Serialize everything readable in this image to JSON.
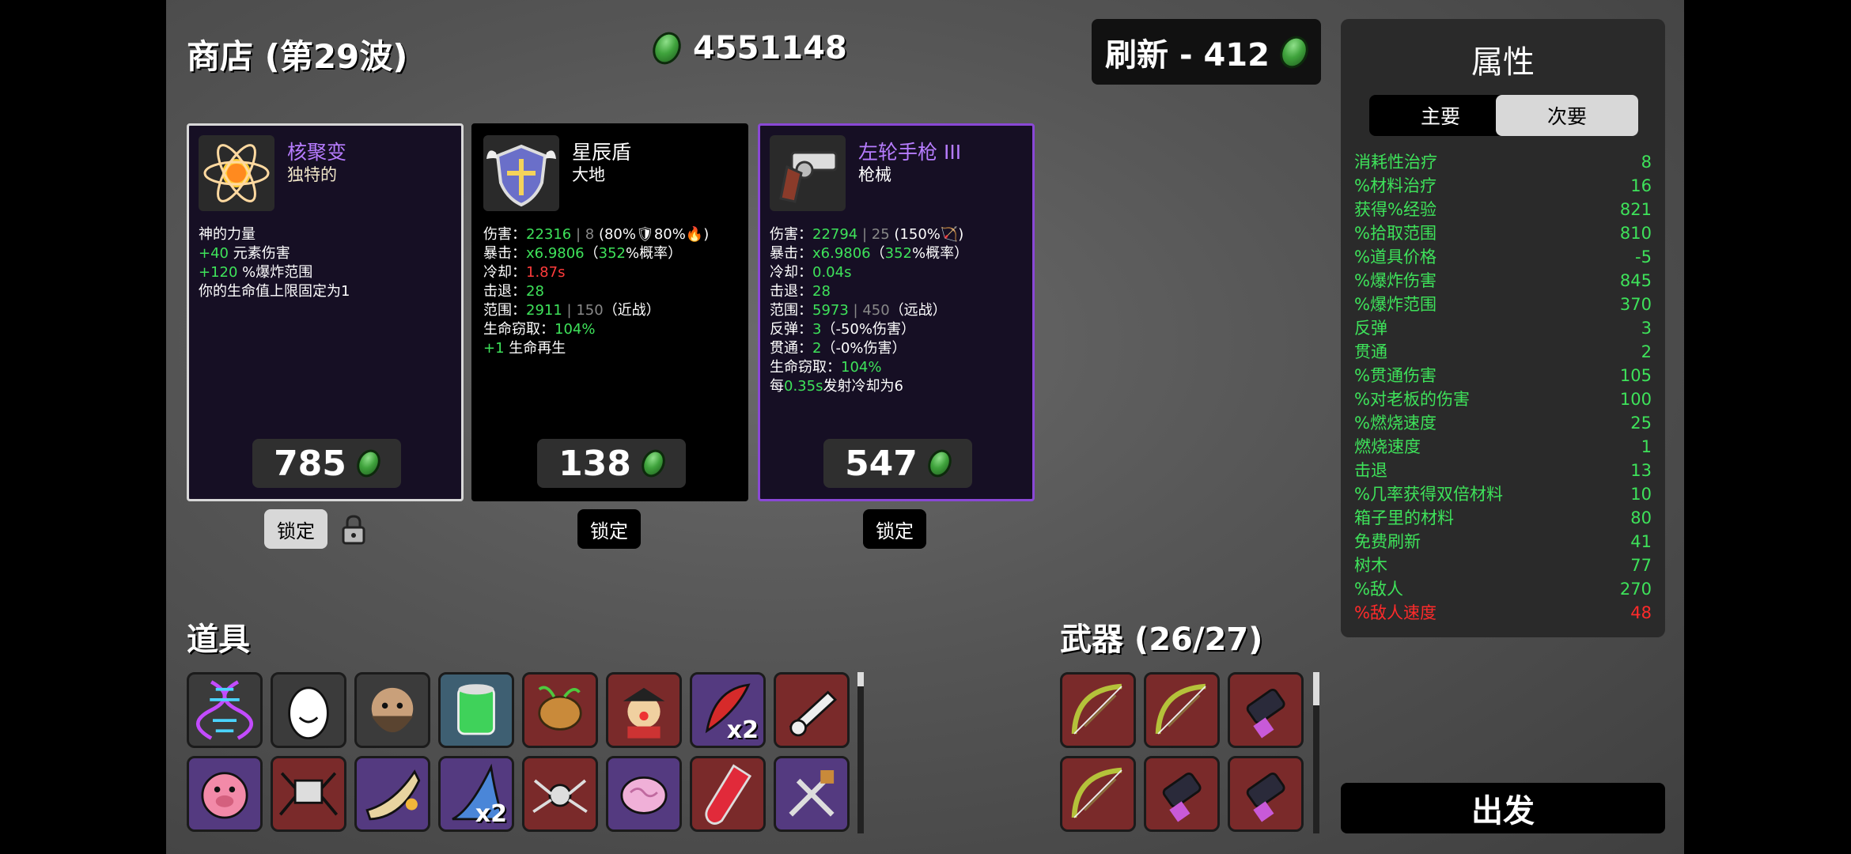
{
  "header": {
    "title": "商店 (第29波)",
    "currency": "4551148",
    "reroll": "刷新 - 412"
  },
  "cards": [
    {
      "name": "核聚变",
      "type": "独特的",
      "price": "785",
      "lock": "锁定",
      "locked": true,
      "lines": [
        {
          "parts": [
            {
              "t": "神的力量"
            }
          ]
        },
        {
          "parts": [
            {
              "t": "+40",
              "c": "g"
            },
            {
              "t": " 元素伤害"
            }
          ]
        },
        {
          "parts": [
            {
              "t": "+120",
              "c": "g"
            },
            {
              "t": " %爆炸范围"
            }
          ]
        },
        {
          "parts": [
            {
              "t": "你的生命值上限固定为1"
            }
          ]
        }
      ]
    },
    {
      "name": "星辰盾",
      "type": "大地",
      "price": "138",
      "lock": "锁定",
      "locked": false,
      "lines": [
        {
          "parts": [
            {
              "t": "伤害："
            },
            {
              "t": "22316",
              "c": "g"
            },
            {
              "t": " | 8",
              "c": "dim"
            },
            {
              "t": " (80%🛡80%🔥)"
            }
          ]
        },
        {
          "parts": [
            {
              "t": "暴击："
            },
            {
              "t": "x6.9806",
              "c": "g"
            },
            {
              "t": "（"
            },
            {
              "t": "352",
              "c": "g"
            },
            {
              "t": "%概率）"
            }
          ]
        },
        {
          "parts": [
            {
              "t": "冷却："
            },
            {
              "t": "1.87s",
              "c": "r"
            }
          ]
        },
        {
          "parts": [
            {
              "t": "击退："
            },
            {
              "t": "28",
              "c": "g"
            }
          ]
        },
        {
          "parts": [
            {
              "t": "范围："
            },
            {
              "t": "2911",
              "c": "g"
            },
            {
              "t": " | 150",
              "c": "dim"
            },
            {
              "t": "（近战）"
            }
          ]
        },
        {
          "parts": [
            {
              "t": "生命窃取："
            },
            {
              "t": "104%",
              "c": "g"
            }
          ]
        },
        {
          "parts": [
            {
              "t": "+1",
              "c": "g"
            },
            {
              "t": " 生命再生"
            }
          ]
        }
      ]
    },
    {
      "name": "左轮手枪 III",
      "type": "枪械",
      "price": "547",
      "lock": "锁定",
      "locked": false,
      "lines": [
        {
          "parts": [
            {
              "t": "伤害："
            },
            {
              "t": "22794",
              "c": "g"
            },
            {
              "t": " | 25",
              "c": "dim"
            },
            {
              "t": " (150%🏹)"
            }
          ]
        },
        {
          "parts": [
            {
              "t": "暴击："
            },
            {
              "t": "x6.9806",
              "c": "g"
            },
            {
              "t": "（"
            },
            {
              "t": "352",
              "c": "g"
            },
            {
              "t": "%概率）"
            }
          ]
        },
        {
          "parts": [
            {
              "t": "冷却："
            },
            {
              "t": "0.04s",
              "c": "g"
            }
          ]
        },
        {
          "parts": [
            {
              "t": "击退："
            },
            {
              "t": "28",
              "c": "g"
            }
          ]
        },
        {
          "parts": [
            {
              "t": "范围："
            },
            {
              "t": "5973",
              "c": "g"
            },
            {
              "t": " | 450",
              "c": "dim"
            },
            {
              "t": "（远战）"
            }
          ]
        },
        {
          "parts": [
            {
              "t": "反弹："
            },
            {
              "t": "3",
              "c": "g"
            },
            {
              "t": "（-50%伤害）"
            }
          ]
        },
        {
          "parts": [
            {
              "t": "贯通："
            },
            {
              "t": "2",
              "c": "g"
            },
            {
              "t": "（-0%伤害）"
            }
          ]
        },
        {
          "parts": [
            {
              "t": "生命窃取："
            },
            {
              "t": "104%",
              "c": "g"
            }
          ]
        },
        {
          "parts": [
            {
              "t": "每"
            },
            {
              "t": "0.35s",
              "c": "g"
            },
            {
              "t": "发射冷却为6"
            }
          ]
        }
      ]
    }
  ],
  "items": {
    "title": "道具",
    "slots": [
      {
        "icon": "dna-icon",
        "tier": "c1"
      },
      {
        "icon": "egg-icon",
        "tier": "c1"
      },
      {
        "icon": "bearded-man-icon",
        "tier": "c1"
      },
      {
        "icon": "green-can-icon",
        "tier": "c2"
      },
      {
        "icon": "potato-icon",
        "tier": "c4"
      },
      {
        "icon": "pirate-clown-icon",
        "tier": "c4"
      },
      {
        "icon": "red-feather-icon",
        "tier": "c3",
        "qty": "x2"
      },
      {
        "icon": "hand-holding-icon",
        "tier": "c4"
      },
      {
        "icon": "pig-icon",
        "tier": "c3"
      },
      {
        "icon": "robot-spider-icon",
        "tier": "c4"
      },
      {
        "icon": "horn-icon",
        "tier": "c3"
      },
      {
        "icon": "shark-fin-icon",
        "tier": "c3",
        "qty": "x2"
      },
      {
        "icon": "spider-icon",
        "tier": "c4"
      },
      {
        "icon": "brain-icon",
        "tier": "c3"
      },
      {
        "icon": "test-tube-icon",
        "tier": "c4"
      },
      {
        "icon": "tools-icon",
        "tier": "c3"
      }
    ]
  },
  "weapons": {
    "title": "武器 (26/27)",
    "slots": [
      {
        "icon": "bow-icon",
        "tier": "c4"
      },
      {
        "icon": "bow-icon",
        "tier": "c4"
      },
      {
        "icon": "minigun-icon",
        "tier": "c4"
      },
      {
        "icon": "bow-icon",
        "tier": "c4"
      },
      {
        "icon": "minigun-icon",
        "tier": "c4"
      },
      {
        "icon": "minigun-icon",
        "tier": "c4"
      }
    ]
  },
  "stats": {
    "title": "属性",
    "tab_primary": "主要",
    "tab_secondary": "次要",
    "rows": [
      {
        "label": "消耗性治疗",
        "value": "8"
      },
      {
        "label": "%材料治疗",
        "value": "16"
      },
      {
        "label": "获得%经验",
        "value": "821"
      },
      {
        "label": "%拾取范围",
        "value": "810"
      },
      {
        "label": "%道具价格",
        "value": "-5"
      },
      {
        "label": "%爆炸伤害",
        "value": "845"
      },
      {
        "label": "%爆炸范围",
        "value": "370"
      },
      {
        "label": "反弹",
        "value": "3"
      },
      {
        "label": "贯通",
        "value": "2"
      },
      {
        "label": "%贯通伤害",
        "value": "105"
      },
      {
        "label": "%对老板的伤害",
        "value": "100"
      },
      {
        "label": "%燃烧速度",
        "value": "25"
      },
      {
        "label": "燃烧速度",
        "value": "1"
      },
      {
        "label": "击退",
        "value": "13"
      },
      {
        "label": "%几率获得双倍材料",
        "value": "10"
      },
      {
        "label": "箱子里的材料",
        "value": "80"
      },
      {
        "label": "免费刷新",
        "value": "41"
      },
      {
        "label": "树木",
        "value": "77"
      },
      {
        "label": "%敌人",
        "value": "270"
      },
      {
        "label": "%敌人速度",
        "value": "48",
        "negative": true
      }
    ]
  },
  "go": "出发",
  "colors": {
    "green": "#3ee25a",
    "red": "#ff3b3b",
    "purple": "#b77cff",
    "legendary_border": "#8a48d6"
  }
}
